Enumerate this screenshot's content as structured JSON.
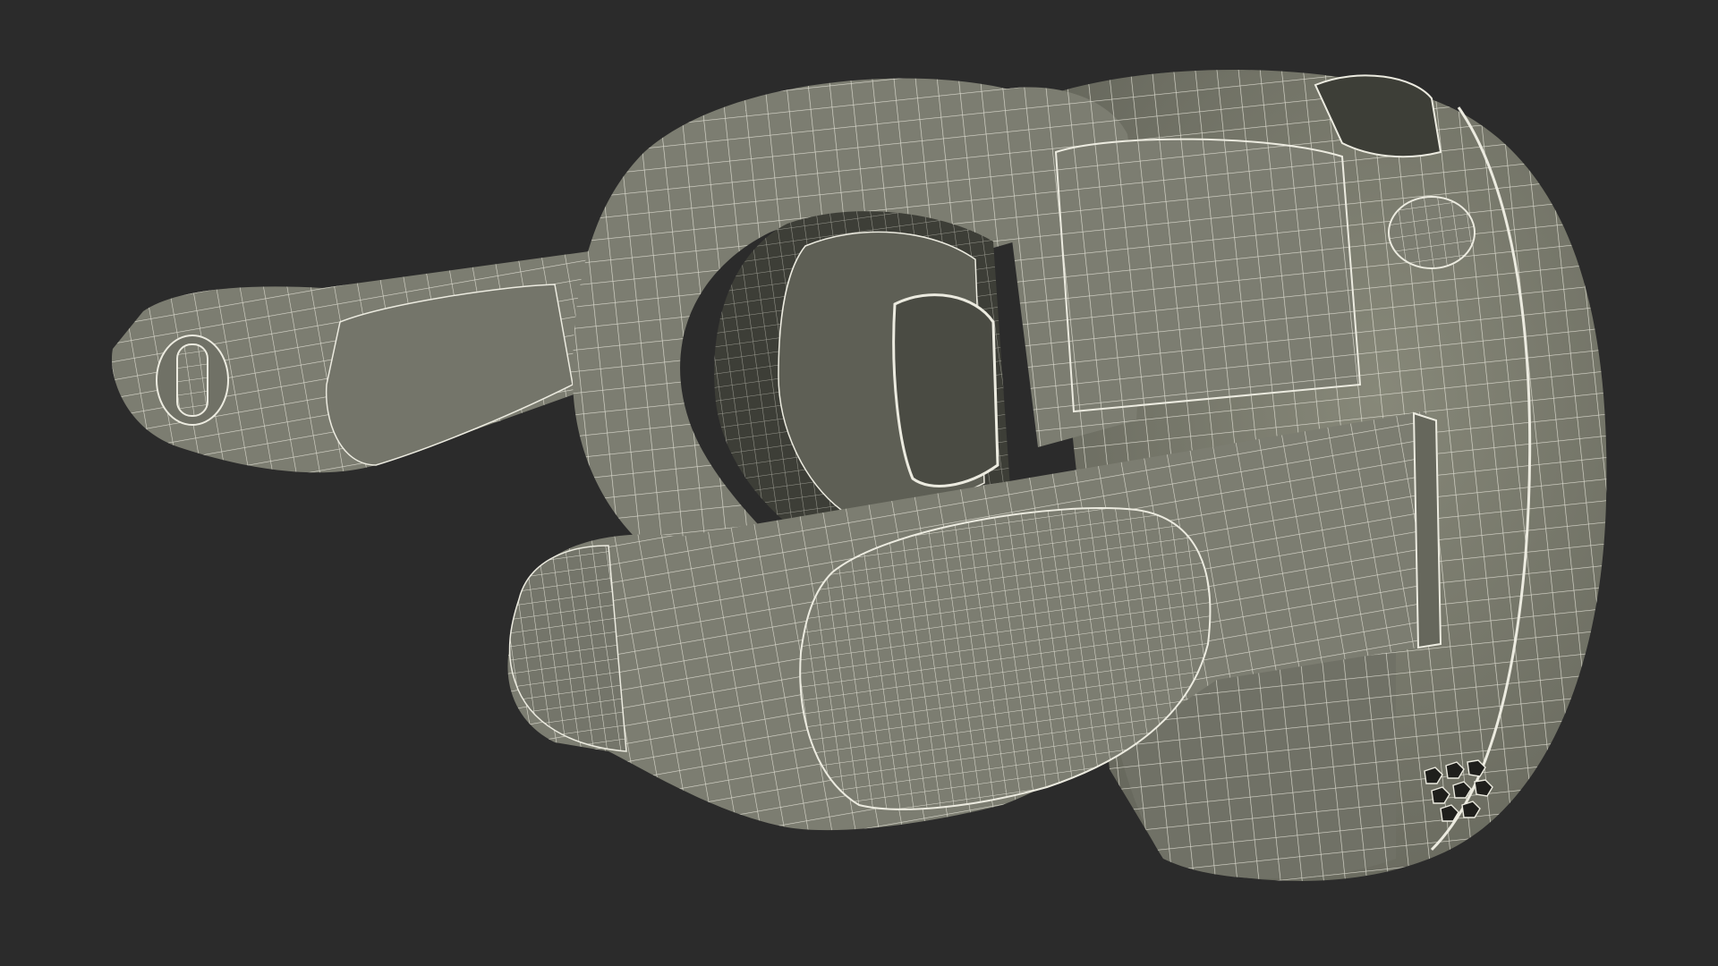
{
  "scene": {
    "background_color": "#2b2b2b",
    "model_fill_color": "#7c7d71",
    "model_shadow_color": "#5e5f55",
    "model_dark_color": "#3d3e37",
    "wire_color": "#ecebe0"
  }
}
